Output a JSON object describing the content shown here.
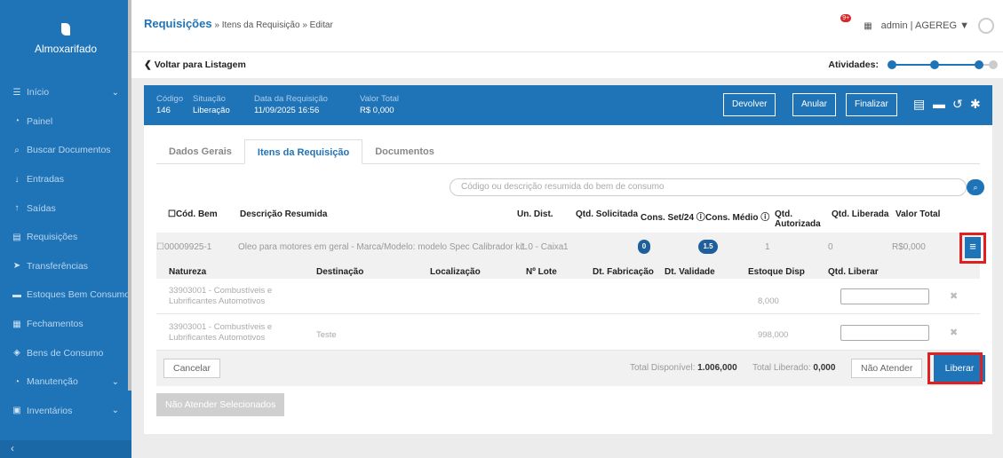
{
  "sidebar": {
    "app_name": "Almoxarifado",
    "items": [
      {
        "label": "Início",
        "icon": "list-icon",
        "glyph": "☰",
        "chev": true
      },
      {
        "label": "Painel",
        "icon": "gauge-icon",
        "glyph": "◔",
        "chev": false
      },
      {
        "label": "Buscar Documentos",
        "icon": "search-icon",
        "glyph": "⌕",
        "chev": false
      },
      {
        "label": "Entradas",
        "icon": "arrow-down-icon",
        "glyph": "↓",
        "chev": false
      },
      {
        "label": "Saídas",
        "icon": "arrow-up-icon",
        "glyph": "↑",
        "chev": false
      },
      {
        "label": "Requisições",
        "icon": "file-icon",
        "glyph": "▤",
        "chev": false
      },
      {
        "label": "Transferências",
        "icon": "send-icon",
        "glyph": "➤",
        "chev": false
      },
      {
        "label": "Estoques Bem Consumo",
        "icon": "warehouse-icon",
        "glyph": "▬",
        "chev": false
      },
      {
        "label": "Fechamentos",
        "icon": "calendar-icon",
        "glyph": "▦",
        "chev": false
      },
      {
        "label": "Bens de Consumo",
        "icon": "tag-icon",
        "glyph": "◈",
        "chev": false
      },
      {
        "label": "Manutenção",
        "icon": "gauge-icon",
        "glyph": "◔",
        "chev": true
      },
      {
        "label": "Inventários",
        "icon": "clipboard-icon",
        "glyph": "▣",
        "chev": true
      }
    ],
    "collapse_glyph": "‹"
  },
  "header": {
    "title": "Requisições",
    "breadcrumb_rest": " » Itens da Requisição » Editar",
    "notif_badge": "9+",
    "user": "admin | AGEREG",
    "back_label": "❮ Voltar para Listagem",
    "activities_label": "Atividades:"
  },
  "info": {
    "codigo_label": "Código",
    "codigo": "146",
    "situacao_label": "Situação",
    "situacao": "Liberação",
    "data_label": "Data da Requisição",
    "data": "11/09/2025 16:56",
    "valor_label": "Valor Total",
    "valor": "R$ 0,000",
    "btn_devolver": "Devolver",
    "btn_anular": "Anular",
    "btn_finalizar": "Finalizar"
  },
  "tabs": [
    "Dados Gerais",
    "Itens da Requisição",
    "Documentos"
  ],
  "search": {
    "placeholder": "Código ou descrição resumida do bem de consumo"
  },
  "table": {
    "headers": {
      "cod": "☐Cód. Bem",
      "desc": "Descrição Resumida",
      "un": "Un. Dist.",
      "qtd_sol": "Qtd. Solicitada",
      "cons_set": "Cons. Set/24 ⓘ",
      "cons_med": "Cons. Médio ⓘ",
      "qtd_aut": "Qtd. Autorizada",
      "qtd_lib": "Qtd. Liberada",
      "valor": "Valor Total"
    },
    "row": {
      "cod": "☐00009925-1",
      "desc": "Oleo para motores em geral - Marca/Modelo: modelo Spec Calibrador kit.",
      "un": "1.0 - Caixa",
      "qtd_sol": "1",
      "cons_set": "0",
      "cons_med": "1.5",
      "qtd_aut": "1",
      "qtd_lib": "0",
      "valor": "R$0,000"
    },
    "sub_headers": {
      "natureza": "Natureza",
      "destinacao": "Destinação",
      "localizacao": "Localização",
      "lote": "Nº Lote",
      "fabricacao": "Dt. Fabricação",
      "validade": "Dt. Validade",
      "estoque": "Estoque Disp",
      "liberar": "Qtd. Liberar"
    },
    "sub_rows": [
      {
        "natureza1": "33903001 - Combustíveis e",
        "natureza2": "Lubrificantes Automotivos",
        "destinacao": "",
        "estoque": "8,000"
      },
      {
        "natureza1": "33903001 - Combustíveis e",
        "natureza2": "Lubrificantes Automotivos",
        "destinacao": "Teste",
        "estoque": "998,000"
      }
    ],
    "footer": {
      "cancel": "Cancelar",
      "total_disp_label": "Total Disponível: ",
      "total_disp": "1.006,000",
      "total_lib_label": "Total Liberado: ",
      "total_lib": "0,000",
      "nao_atender": "Não Atender",
      "liberar": "Liberar"
    },
    "nao_atender_sel": "Não Atender Selecionados"
  },
  "colors": {
    "primary": "#1f73b7",
    "highlight": "#e02020"
  }
}
